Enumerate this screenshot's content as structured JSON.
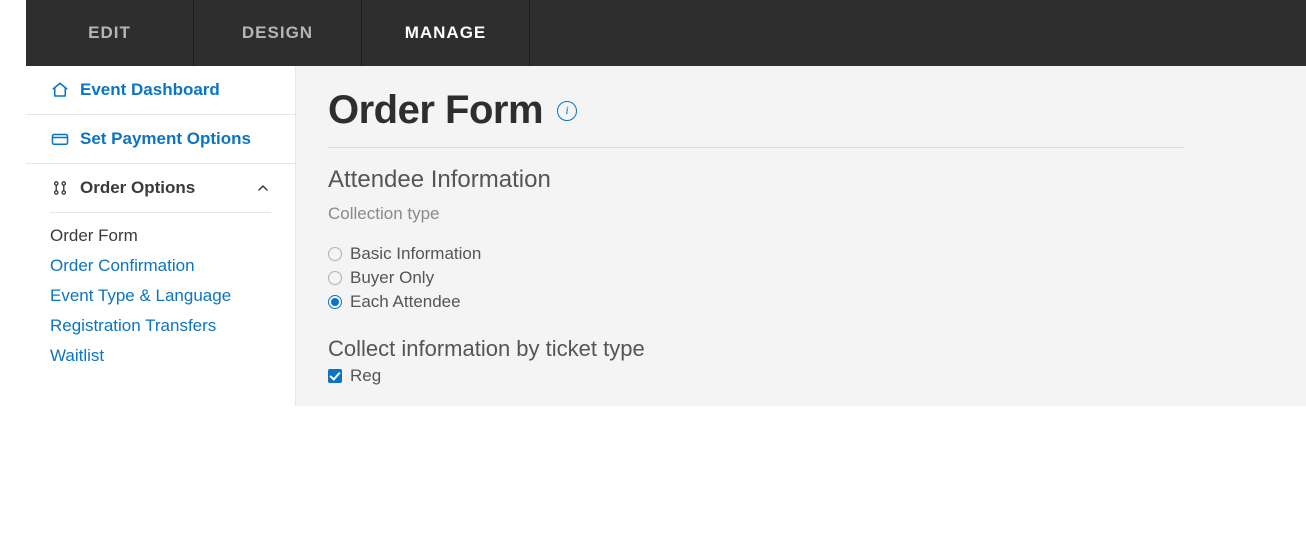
{
  "topnav": {
    "tabs": [
      {
        "label": "EDIT",
        "active": false
      },
      {
        "label": "DESIGN",
        "active": false
      },
      {
        "label": "MANAGE",
        "active": true
      }
    ]
  },
  "sidebar": {
    "dashboard_label": "Event Dashboard",
    "payment_label": "Set Payment Options",
    "group_label": "Order Options",
    "sub_items": {
      "order_form": "Order Form",
      "order_confirmation": "Order Confirmation",
      "event_type_lang": "Event Type & Language",
      "registration_transfers": "Registration Transfers",
      "waitlist": "Waitlist"
    }
  },
  "main": {
    "title": "Order Form",
    "section_heading": "Attendee Information",
    "collection_label": "Collection type",
    "radios": {
      "basic": "Basic Information",
      "buyer": "Buyer Only",
      "each": "Each Attendee"
    },
    "selected_radio": "each",
    "ticket_heading": "Collect information by ticket type",
    "ticket_checkbox_label": "Reg",
    "ticket_checked": true
  },
  "colors": {
    "accent": "#0b74c5"
  }
}
